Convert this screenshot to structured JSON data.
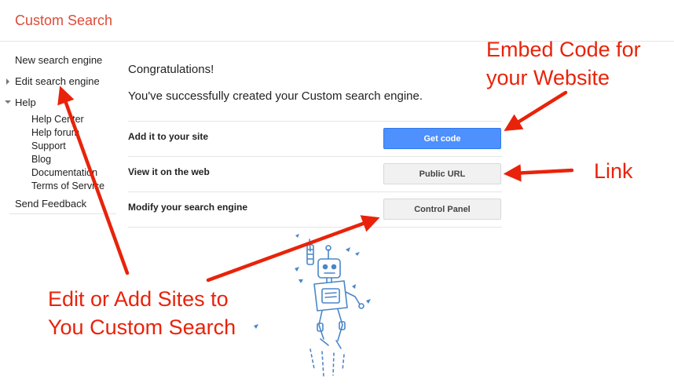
{
  "header": {
    "title": "Custom Search"
  },
  "sidebar": {
    "items": [
      {
        "label": "New search engine"
      },
      {
        "label": "Edit search engine"
      },
      {
        "label": "Help"
      },
      {
        "label": "Send Feedback"
      }
    ],
    "help_items": [
      "Help Center",
      "Help forum",
      "Support",
      "Blog",
      "Documentation",
      "Terms of Service"
    ]
  },
  "main": {
    "congrats": "Congratulations!",
    "success": "You've successfully created your Custom search engine.",
    "rows": [
      {
        "label": "Add it to your site",
        "button": "Get code"
      },
      {
        "label": "View it on the web",
        "button": "Public URL"
      },
      {
        "label": "Modify your search engine",
        "button": "Control Panel"
      }
    ]
  },
  "annotations": {
    "embed": [
      "Embed Code for",
      "your Website"
    ],
    "link": "Link",
    "edit": [
      "Edit or Add Sites to",
      "You Custom Search"
    ]
  },
  "colors": {
    "title": "#dd4b39",
    "primary_button": "#4d90fe",
    "annotation": "#e8230a",
    "robot": "#4a86c8"
  }
}
